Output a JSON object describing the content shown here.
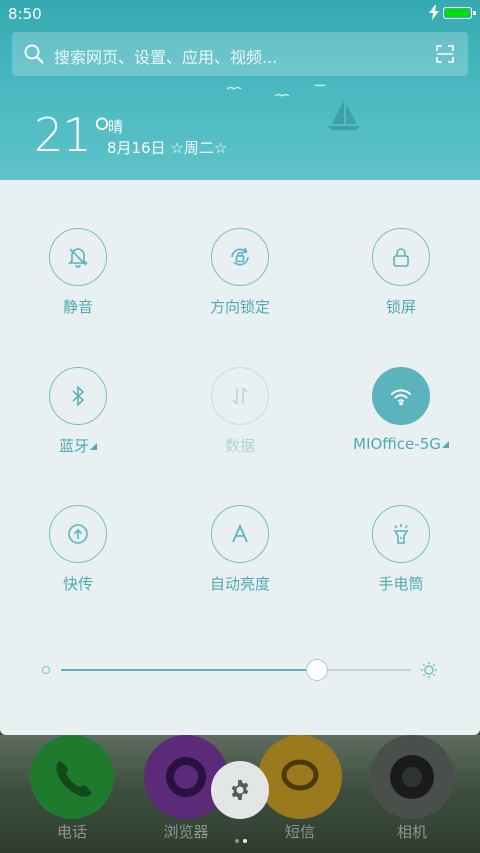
{
  "status_bar": {
    "time": "8:50",
    "charging_icon": "bolt-icon",
    "battery_fill_fraction": 1.0,
    "battery_color": "#00e000"
  },
  "search": {
    "placeholder": "搜索网页、设置、应用、视频...",
    "icon": "search-icon",
    "scan_icon": "scan-icon"
  },
  "weather": {
    "temperature": "21°",
    "condition": "晴",
    "date": "8月16日 ☆周二☆"
  },
  "toggles": [
    {
      "label": "静音",
      "icon": "bell-off-icon",
      "state": "off"
    },
    {
      "label": "方向锁定",
      "icon": "rotation-lock-icon",
      "state": "off"
    },
    {
      "label": "锁屏",
      "icon": "lock-icon",
      "state": "off"
    },
    {
      "label": "蓝牙",
      "icon": "bluetooth-icon",
      "state": "off"
    },
    {
      "label": "数据",
      "icon": "mobile-data-icon",
      "state": "disabled"
    },
    {
      "label": "MIOffice-5G",
      "icon": "wifi-icon",
      "state": "on"
    },
    {
      "label": "快传",
      "icon": "transfer-icon",
      "state": "off"
    },
    {
      "label": "自动亮度",
      "icon": "auto-brightness-icon",
      "state": "off"
    },
    {
      "label": "手电筒",
      "icon": "flashlight-icon",
      "state": "off"
    }
  ],
  "brightness": {
    "level_fraction": 0.73,
    "min_icon": "brightness-low-icon",
    "max_icon": "brightness-high-icon"
  },
  "dock": {
    "apps": [
      {
        "label": "电话",
        "icon": "phone-icon",
        "color": "#1f7a2e"
      },
      {
        "label": "浏览器",
        "icon": "browser-icon",
        "color": "#5b2a78"
      },
      {
        "label": "短信",
        "icon": "message-icon",
        "color": "#9a7a1c"
      },
      {
        "label": "相机",
        "icon": "camera-icon",
        "color": "#4a4f4c"
      }
    ],
    "settings_icon": "gear-icon",
    "page_count": 2,
    "current_page": 2
  },
  "colors": {
    "accent": "#5bb4bd",
    "panel": "#e9f0f2",
    "header": "#48b8c0"
  }
}
